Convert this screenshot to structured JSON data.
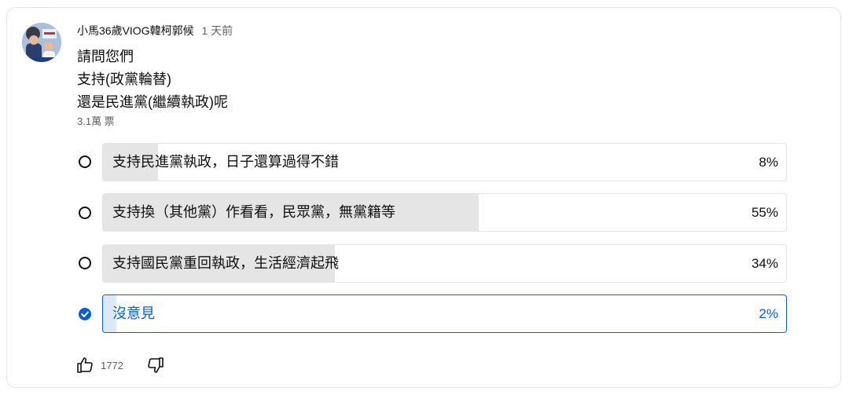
{
  "comment": {
    "channel": "小馬36歲VIOG韓柯郭候",
    "time": "1 天前",
    "text_lines": [
      "請問您們",
      "支持(政黨輪替)",
      "還是民進黨(繼續執政)呢"
    ],
    "vote_count": "3.1萬 票"
  },
  "poll": {
    "options": [
      {
        "label": "支持民進黨執政，日子還算過得不錯",
        "percent_text": "8%",
        "percent": 8,
        "selected": false
      },
      {
        "label": "支持換（其他黨）作看看，民眾黨，無黨籍等",
        "percent_text": "55%",
        "percent": 55,
        "selected": false
      },
      {
        "label": "支持國民黨重回執政，生活經濟起飛",
        "percent_text": "34%",
        "percent": 34,
        "selected": false
      },
      {
        "label": "沒意見",
        "percent_text": "2%",
        "percent": 2,
        "selected": true
      }
    ]
  },
  "actions": {
    "like_count": "1772",
    "like_icon": "thumb-up-icon",
    "dislike_icon": "thumb-down-icon"
  },
  "colors": {
    "accent": "#065fd4",
    "bar_fill": "#e5e5e5",
    "selected_fill": "#dde8fa"
  }
}
